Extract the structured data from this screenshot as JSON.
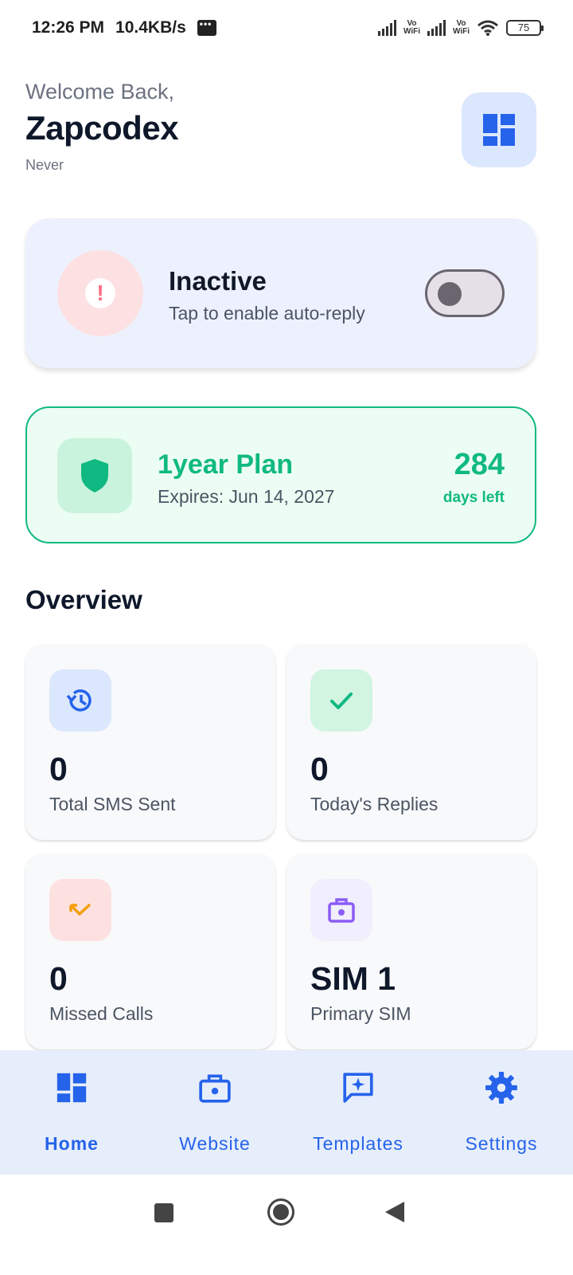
{
  "status_bar": {
    "time": "12:26 PM",
    "speed": "10.4KB/s",
    "network_1": "Vo WiFi",
    "network_2": "Vo WiFi",
    "battery": "75"
  },
  "header": {
    "welcome": "Welcome Back,",
    "username": "Zapcodex",
    "last_seen": "Never",
    "dashboard_icon": "dashboard-icon"
  },
  "status_card": {
    "title": "Inactive",
    "subtitle": "Tap to enable auto-reply",
    "icon": "alert-icon",
    "toggle_on": false
  },
  "plan_card": {
    "title": "1year Plan",
    "expires": "Expires: Jun 14, 2027",
    "days": "284",
    "days_label": "days left",
    "icon": "shield-icon"
  },
  "overview": {
    "title": "Overview",
    "stats": [
      {
        "value": "0",
        "label": "Total SMS Sent",
        "icon": "history-icon",
        "color": "#2563eb",
        "bg": "#dbe7fd"
      },
      {
        "value": "0",
        "label": "Today's Replies",
        "icon": "check-icon",
        "color": "#10b981",
        "bg": "#d1f5e1"
      },
      {
        "value": "0",
        "label": "Missed Calls",
        "icon": "missed-call-icon",
        "color": "#f59e0b",
        "bg": "#fde1e1"
      },
      {
        "value": "SIM 1",
        "label": "Primary SIM",
        "icon": "sim-icon",
        "color": "#8b5cf6",
        "bg": "#f1eefd"
      }
    ]
  },
  "bottom_nav": {
    "items": [
      {
        "label": "Home",
        "icon": "dashboard-icon",
        "active": true
      },
      {
        "label": "Website",
        "icon": "website-icon",
        "active": false
      },
      {
        "label": "Templates",
        "icon": "templates-icon",
        "active": false
      },
      {
        "label": "Settings",
        "icon": "gear-icon",
        "active": false
      }
    ]
  },
  "colors": {
    "primary": "#2563eb",
    "success": "#10b981",
    "danger_soft": "#fde0e2",
    "card_bg": "#edf1fd"
  }
}
